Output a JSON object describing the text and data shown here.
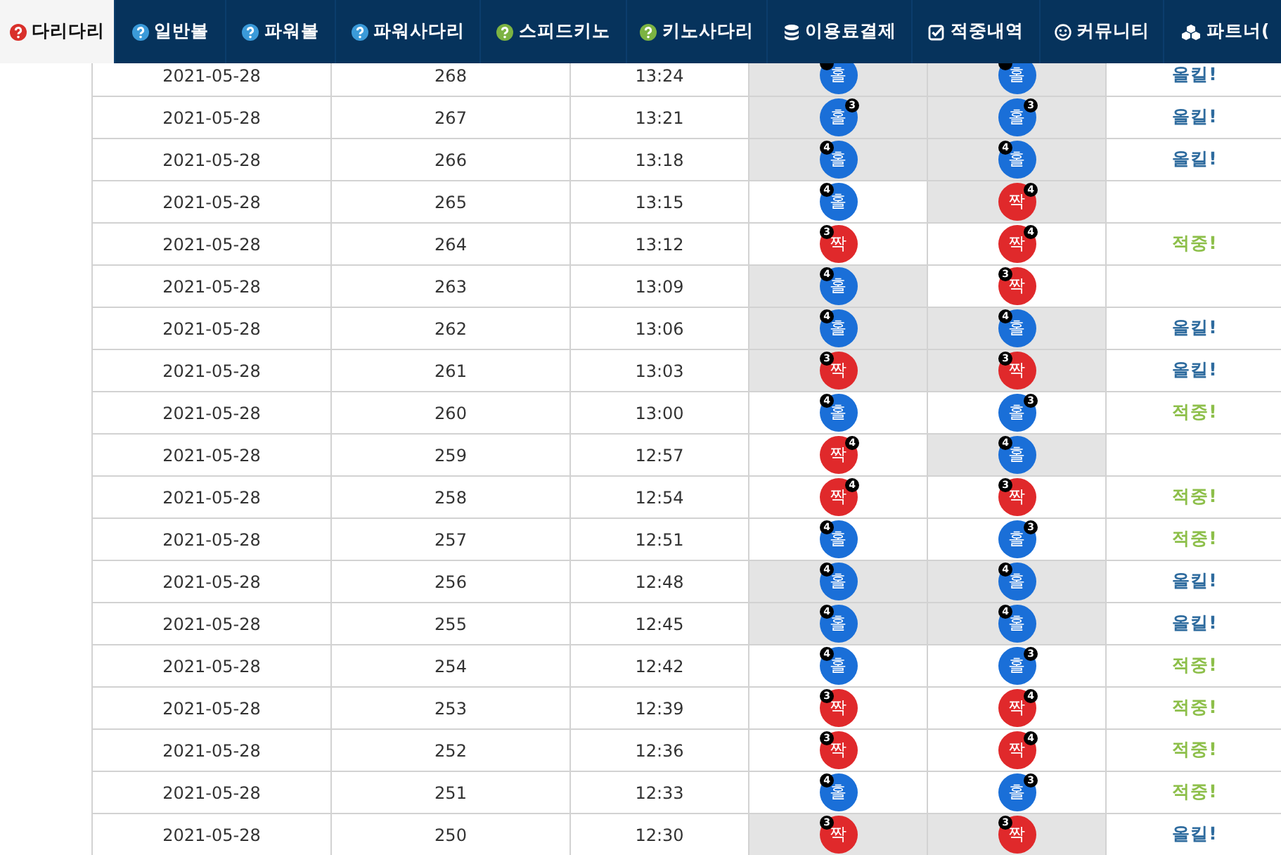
{
  "tabs": [
    {
      "label": "다리다리",
      "selected": true,
      "kind": "help",
      "color": "#d9302b"
    },
    {
      "label": "일반볼",
      "selected": false,
      "kind": "help",
      "color": "#3a9ad9"
    },
    {
      "label": "파워볼",
      "selected": false,
      "kind": "help",
      "color": "#3a9ad9"
    },
    {
      "label": "파워사다리",
      "selected": false,
      "kind": "help",
      "color": "#3a9ad9"
    },
    {
      "label": "스피드키노",
      "selected": false,
      "kind": "help",
      "color": "#7cb342"
    },
    {
      "label": "키노사다리",
      "selected": false,
      "kind": "help",
      "color": "#7cb342"
    },
    {
      "label": "이용료결제",
      "selected": false,
      "kind": "payment"
    },
    {
      "label": "적중내역",
      "selected": false,
      "kind": "history"
    },
    {
      "label": "커뮤니티",
      "selected": false,
      "kind": "community"
    },
    {
      "label": "파트너(",
      "selected": false,
      "kind": "partner"
    }
  ],
  "rows": [
    {
      "date": "2021-05-28",
      "round": "268",
      "time": "13:24",
      "result": {
        "kind": "odd",
        "label": "홀",
        "badge_left": true,
        "shaded": true
      },
      "pick": {
        "kind": "odd",
        "label": "홀",
        "badge_left": true,
        "shaded": true
      },
      "outcome": {
        "kind": "allkill",
        "label": "올킬!"
      }
    },
    {
      "date": "2021-05-28",
      "round": "267",
      "time": "13:21",
      "result": {
        "kind": "odd",
        "label": "홀",
        "badge_left": false,
        "lines": "3",
        "shaded": true
      },
      "pick": {
        "kind": "odd",
        "label": "홀",
        "badge_left": false,
        "lines": "3",
        "shaded": true
      },
      "outcome": {
        "kind": "allkill",
        "label": "올킬!"
      }
    },
    {
      "date": "2021-05-28",
      "round": "266",
      "time": "13:18",
      "result": {
        "kind": "odd",
        "label": "홀",
        "badge_left": true,
        "lines": "4",
        "shaded": true
      },
      "pick": {
        "kind": "odd",
        "label": "홀",
        "badge_left": true,
        "lines": "4",
        "shaded": true
      },
      "outcome": {
        "kind": "allkill",
        "label": "올킬!"
      }
    },
    {
      "date": "2021-05-28",
      "round": "265",
      "time": "13:15",
      "result": {
        "kind": "odd",
        "label": "홀",
        "badge_left": true,
        "lines": "4",
        "shaded": false
      },
      "pick": {
        "kind": "even",
        "label": "짝",
        "badge_left": false,
        "lines": "4",
        "shaded": true
      }
    },
    {
      "date": "2021-05-28",
      "round": "264",
      "time": "13:12",
      "result": {
        "kind": "even",
        "label": "짝",
        "badge_left": true,
        "lines": "3",
        "shaded": false
      },
      "pick": {
        "kind": "even",
        "label": "짝",
        "badge_left": false,
        "lines": "4",
        "shaded": false
      },
      "outcome": {
        "kind": "hit",
        "label": "적중!"
      }
    },
    {
      "date": "2021-05-28",
      "round": "263",
      "time": "13:09",
      "result": {
        "kind": "odd",
        "label": "홀",
        "badge_left": true,
        "lines": "4",
        "shaded": true
      },
      "pick": {
        "kind": "even",
        "label": "짝",
        "badge_left": true,
        "lines": "3",
        "shaded": false
      }
    },
    {
      "date": "2021-05-28",
      "round": "262",
      "time": "13:06",
      "result": {
        "kind": "odd",
        "label": "홀",
        "badge_left": true,
        "lines": "4",
        "shaded": true
      },
      "pick": {
        "kind": "odd",
        "label": "홀",
        "badge_left": true,
        "lines": "4",
        "shaded": true
      },
      "outcome": {
        "kind": "allkill",
        "label": "올킬!"
      }
    },
    {
      "date": "2021-05-28",
      "round": "261",
      "time": "13:03",
      "result": {
        "kind": "even",
        "label": "짝",
        "badge_left": true,
        "lines": "3",
        "shaded": true
      },
      "pick": {
        "kind": "even",
        "label": "짝",
        "badge_left": true,
        "lines": "3",
        "shaded": true
      },
      "outcome": {
        "kind": "allkill",
        "label": "올킬!"
      }
    },
    {
      "date": "2021-05-28",
      "round": "260",
      "time": "13:00",
      "result": {
        "kind": "odd",
        "label": "홀",
        "badge_left": true,
        "lines": "4",
        "shaded": false
      },
      "pick": {
        "kind": "odd",
        "label": "홀",
        "badge_left": false,
        "lines": "3",
        "shaded": false
      },
      "outcome": {
        "kind": "hit",
        "label": "적중!"
      }
    },
    {
      "date": "2021-05-28",
      "round": "259",
      "time": "12:57",
      "result": {
        "kind": "even",
        "label": "짝",
        "badge_left": false,
        "lines": "4",
        "shaded": false
      },
      "pick": {
        "kind": "odd",
        "label": "홀",
        "badge_left": true,
        "lines": "4",
        "shaded": true
      }
    },
    {
      "date": "2021-05-28",
      "round": "258",
      "time": "12:54",
      "result": {
        "kind": "even",
        "label": "짝",
        "badge_left": false,
        "lines": "4",
        "shaded": false
      },
      "pick": {
        "kind": "even",
        "label": "짝",
        "badge_left": true,
        "lines": "3",
        "shaded": false
      },
      "outcome": {
        "kind": "hit",
        "label": "적중!"
      }
    },
    {
      "date": "2021-05-28",
      "round": "257",
      "time": "12:51",
      "result": {
        "kind": "odd",
        "label": "홀",
        "badge_left": true,
        "lines": "4",
        "shaded": false
      },
      "pick": {
        "kind": "odd",
        "label": "홀",
        "badge_left": false,
        "lines": "3",
        "shaded": false
      },
      "outcome": {
        "kind": "hit",
        "label": "적중!"
      }
    },
    {
      "date": "2021-05-28",
      "round": "256",
      "time": "12:48",
      "result": {
        "kind": "odd",
        "label": "홀",
        "badge_left": true,
        "lines": "4",
        "shaded": true
      },
      "pick": {
        "kind": "odd",
        "label": "홀",
        "badge_left": true,
        "lines": "4",
        "shaded": true
      },
      "outcome": {
        "kind": "allkill",
        "label": "올킬!"
      }
    },
    {
      "date": "2021-05-28",
      "round": "255",
      "time": "12:45",
      "result": {
        "kind": "odd",
        "label": "홀",
        "badge_left": true,
        "lines": "4",
        "shaded": true
      },
      "pick": {
        "kind": "odd",
        "label": "홀",
        "badge_left": true,
        "lines": "4",
        "shaded": true
      },
      "outcome": {
        "kind": "allkill",
        "label": "올킬!"
      }
    },
    {
      "date": "2021-05-28",
      "round": "254",
      "time": "12:42",
      "result": {
        "kind": "odd",
        "label": "홀",
        "badge_left": true,
        "lines": "4",
        "shaded": false
      },
      "pick": {
        "kind": "odd",
        "label": "홀",
        "badge_left": false,
        "lines": "3",
        "shaded": false
      },
      "outcome": {
        "kind": "hit",
        "label": "적중!"
      }
    },
    {
      "date": "2021-05-28",
      "round": "253",
      "time": "12:39",
      "result": {
        "kind": "even",
        "label": "짝",
        "badge_left": true,
        "lines": "3",
        "shaded": false
      },
      "pick": {
        "kind": "even",
        "label": "짝",
        "badge_left": false,
        "lines": "4",
        "shaded": false
      },
      "outcome": {
        "kind": "hit",
        "label": "적중!"
      }
    },
    {
      "date": "2021-05-28",
      "round": "252",
      "time": "12:36",
      "result": {
        "kind": "even",
        "label": "짝",
        "badge_left": true,
        "lines": "3",
        "shaded": false
      },
      "pick": {
        "kind": "even",
        "label": "짝",
        "badge_left": false,
        "lines": "4",
        "shaded": false
      },
      "outcome": {
        "kind": "hit",
        "label": "적중!"
      }
    },
    {
      "date": "2021-05-28",
      "round": "251",
      "time": "12:33",
      "result": {
        "kind": "odd",
        "label": "홀",
        "badge_left": true,
        "lines": "4",
        "shaded": false
      },
      "pick": {
        "kind": "odd",
        "label": "홀",
        "badge_left": false,
        "lines": "3",
        "shaded": false
      },
      "outcome": {
        "kind": "hit",
        "label": "적중!"
      }
    },
    {
      "date": "2021-05-28",
      "round": "250",
      "time": "12:30",
      "result": {
        "kind": "even",
        "label": "짝",
        "badge_left": true,
        "lines": "3",
        "shaded": true
      },
      "pick": {
        "kind": "even",
        "label": "짝",
        "badge_left": true,
        "lines": "3",
        "shaded": true
      },
      "outcome": {
        "kind": "allkill",
        "label": "올킬!"
      }
    }
  ]
}
